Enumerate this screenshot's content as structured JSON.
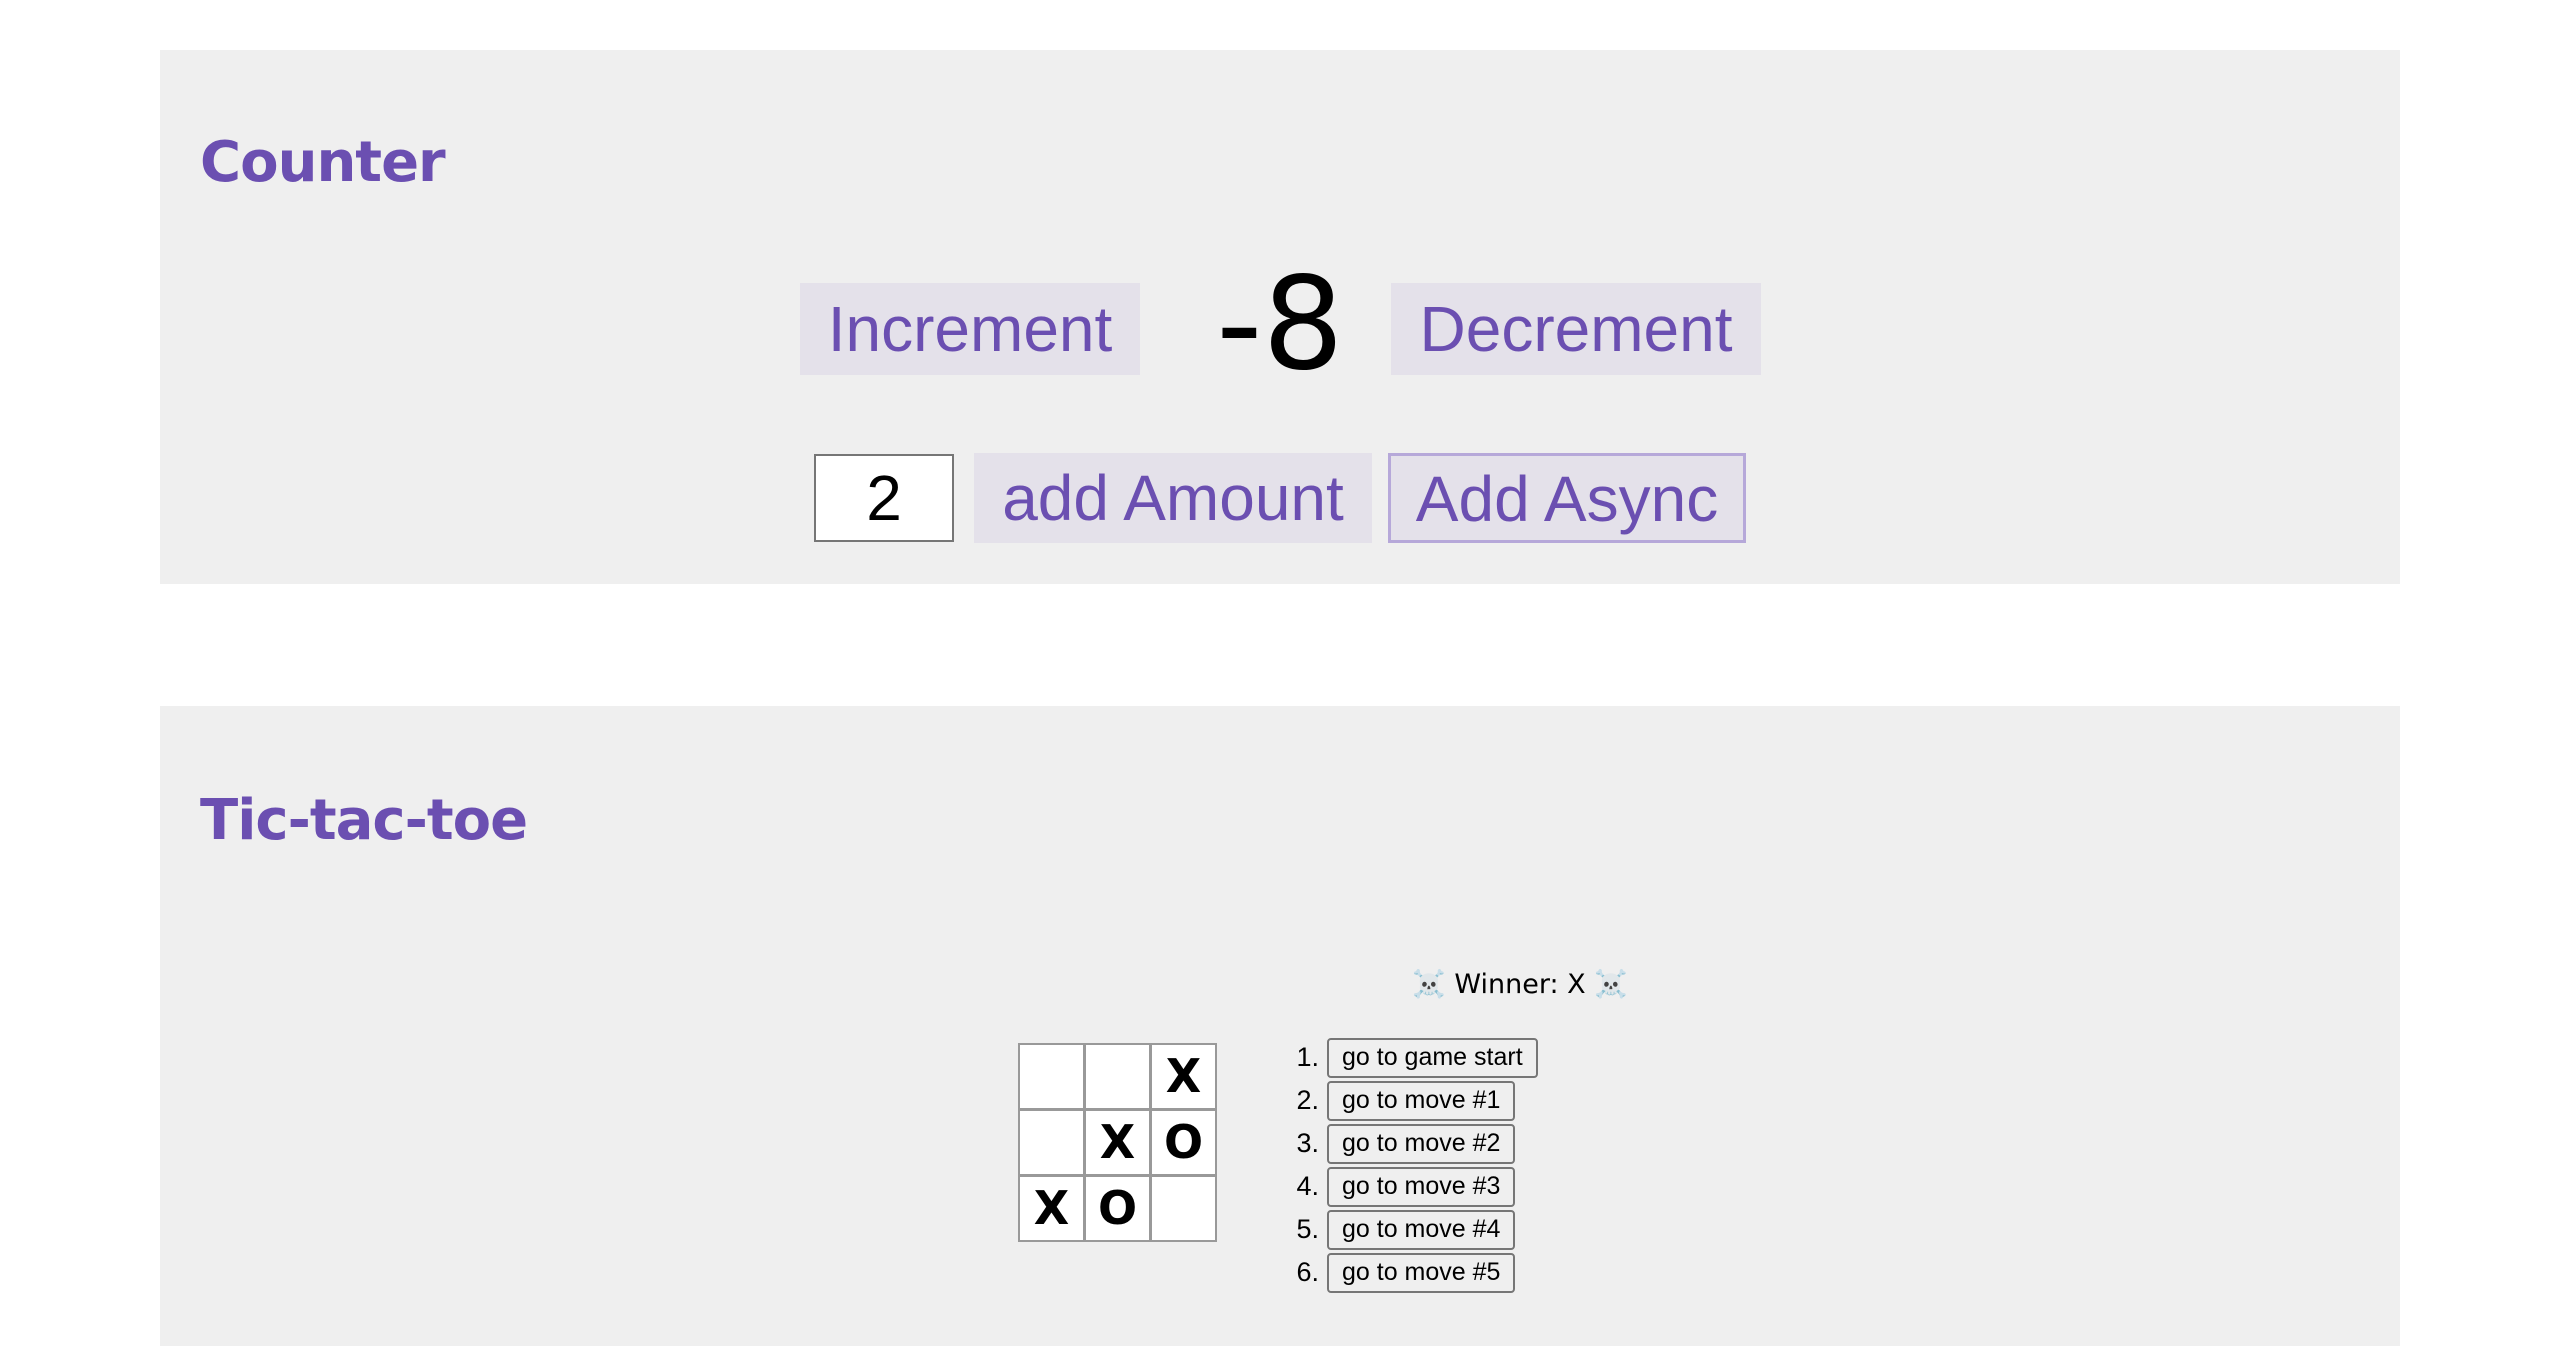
{
  "counter": {
    "title": "Counter",
    "increment_label": "Increment",
    "value": "-8",
    "decrement_label": "Decrement",
    "amount_value": "2",
    "add_amount_label": "add Amount",
    "add_async_label": "Add Async"
  },
  "tictactoe": {
    "title": "Tic-tac-toe",
    "status": "☠️ Winner: X ☠️",
    "board": [
      "",
      "",
      "X",
      "",
      "X",
      "O",
      "X",
      "O",
      ""
    ],
    "moves": [
      {
        "num": "1.",
        "label": "go to game start"
      },
      {
        "num": "2.",
        "label": "go to move #1"
      },
      {
        "num": "3.",
        "label": "go to move #2"
      },
      {
        "num": "4.",
        "label": "go to move #3"
      },
      {
        "num": "5.",
        "label": "go to move #4"
      },
      {
        "num": "6.",
        "label": "go to move #5"
      }
    ]
  },
  "colors": {
    "accent": "#6b4fb1",
    "section_bg": "#efefef",
    "button_bg": "#e4e1ea"
  }
}
